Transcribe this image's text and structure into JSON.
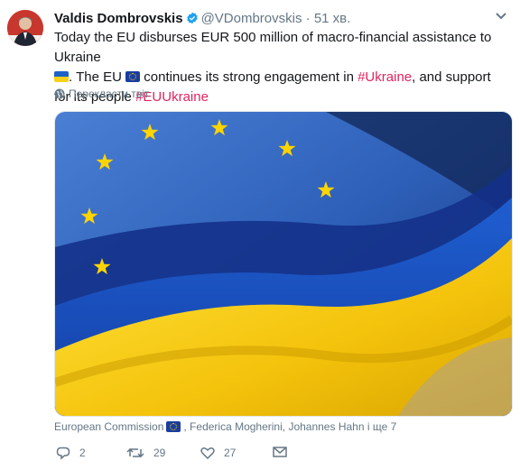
{
  "tweet": {
    "author_name": "Valdis Dombrovskis",
    "author_handle": "@VDombrovskis",
    "separator": "·",
    "time": "51 хв.",
    "text_line1": "Today the EU disburses EUR 500 million of macro-financial assistance to Ukraine",
    "text_part2": ". The EU",
    "text_part3": "continues its strong  engagement in",
    "hashtag1": "#Ukraine",
    "text_part4": ", and support for its people",
    "hashtag2": "#EUUkraine",
    "translate_label": "Перекласти твіт",
    "tagged_first": "European Commission",
    "tagged_rest": ", Federica Mogherini, Johannes Hahn і ще 7"
  },
  "actions": {
    "replies": "2",
    "retweets": "29",
    "likes": "27"
  },
  "icons": {
    "verified": "verified-badge-icon",
    "chevron": "chevron-down-icon",
    "globe": "globe-icon",
    "reply": "reply-icon",
    "retweet": "retweet-icon",
    "like": "heart-icon",
    "dm": "envelope-icon"
  },
  "colors": {
    "text": "#14171a",
    "muted": "#657786",
    "hashtag": "#e0245e",
    "verified": "#1da1f2",
    "flag_blue": "#1d5bc4",
    "flag_yellow": "#f5cf0d"
  }
}
